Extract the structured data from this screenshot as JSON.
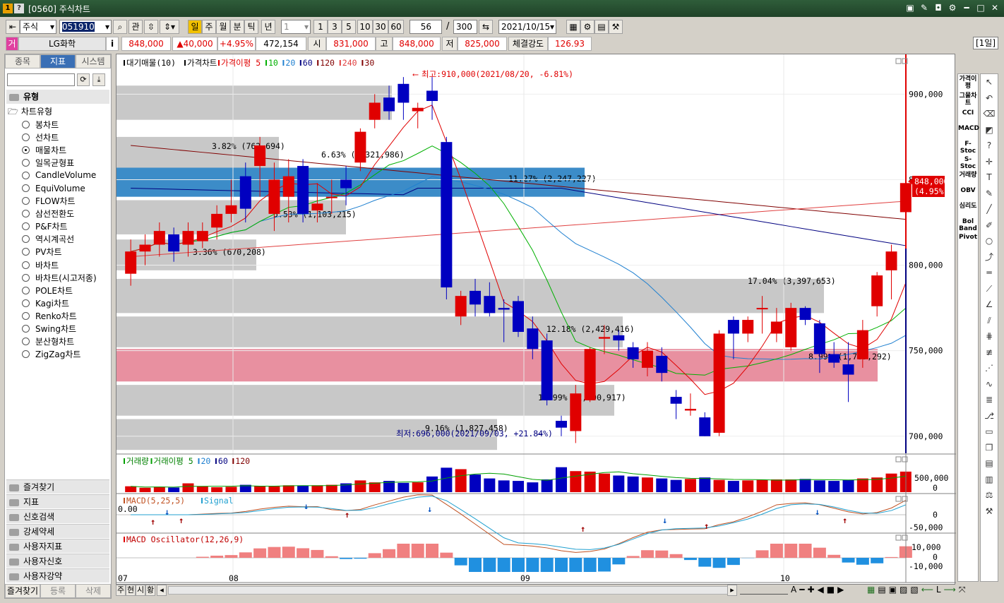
{
  "window": {
    "badge1": "1",
    "badge2": "?",
    "title": "[0560] 주식차트"
  },
  "toolbar": {
    "market": "주식",
    "code": "051910",
    "btn_gwan": "관",
    "units": [
      "일",
      "주",
      "월",
      "분",
      "틱",
      "년"
    ],
    "interval_value": "1",
    "quick_intervals": [
      "1",
      "3",
      "5",
      "10",
      "30",
      "60"
    ],
    "count_value": "56",
    "slash": "/",
    "total_value": "300",
    "date_value": "2021/10/15"
  },
  "quote": {
    "badge": "거",
    "name": "LG화학",
    "info_icon": "i",
    "price": "848,000",
    "change": "▲40,000",
    "change_pct": "+4.95%",
    "volume": "472,154",
    "open_label": "시",
    "open": "831,000",
    "high_label": "고",
    "high": "848,000",
    "low_label": "저",
    "low": "825,000",
    "strength_label": "체결강도",
    "strength": "126.93",
    "period_tag": "[1일]"
  },
  "left_panel": {
    "tabs": [
      "종목",
      "지표",
      "시스템"
    ],
    "active_tab": 1,
    "section": "유형",
    "tree_root": "차트유형",
    "chart_types": [
      "봉차트",
      "선차트",
      "매물차트",
      "일목균형표",
      "CandleVolume",
      "EquiVolume",
      "FLOW차트",
      "삼선전환도",
      "P&F차트",
      "역시계곡선",
      "PV차트",
      "바차트",
      "바차트(시고저종)",
      "POLE차트",
      "Kagi차트",
      "Renko차트",
      "Swing차트",
      "분산형차트",
      "ZigZag차트"
    ],
    "selected_type": 2,
    "bottom_folders": [
      "즐겨찾기",
      "지표",
      "신호검색",
      "강세약세",
      "사용자지표",
      "사용자신호",
      "사용자강약"
    ],
    "footer": [
      "즐겨찾기",
      "등록",
      "삭제"
    ]
  },
  "legend_main": [
    {
      "text": "대기매물(10)",
      "color": "#000000"
    },
    {
      "text": "가격차트",
      "color": "#000000"
    },
    {
      "text": "가격이평 5",
      "color": "#e00000"
    },
    {
      "text": "10",
      "color": "#00b000"
    },
    {
      "text": "20",
      "color": "#2080d0"
    },
    {
      "text": "60",
      "color": "#000080"
    },
    {
      "text": "120",
      "color": "#800000"
    },
    {
      "text": "240",
      "color": "#e04040"
    },
    {
      "text": "30",
      "color": "#800000"
    }
  ],
  "annotations": {
    "high": "최고:910,000(2021/08/20, -6.81%)",
    "low": "최저:696,000(2021/09/03, +21.84%)",
    "current_price": "848,000",
    "current_pct": "(4.95%)"
  },
  "volume_profile": [
    {
      "label": "6.63% (1,321,986)",
      "color": "gray"
    },
    {
      "label": "3.82% (762,694)",
      "color": "gray"
    },
    {
      "label": "11.27% (2,247,227)",
      "color": "blue"
    },
    {
      "label": "5.53% (1,103,215)",
      "color": "gray"
    },
    {
      "label": "3.36% (670,208)",
      "color": "gray"
    },
    {
      "label": "17.04% (3,397,653)",
      "color": "gray"
    },
    {
      "label": "12.18% (2,429,416)",
      "color": "gray"
    },
    {
      "label": "8.99% (1,789,292)",
      "color": "pink"
    },
    {
      "label": "11.99% (2,390,917)",
      "color": "gray"
    },
    {
      "label": "9.16% (1,827,458)",
      "color": "gray"
    }
  ],
  "price_axis": [
    "900,000",
    "850,000",
    "800,000",
    "750,000",
    "700,000"
  ],
  "volume_panel": {
    "legend": [
      "거래량",
      "거래이평 5",
      "20",
      "60",
      "120"
    ],
    "axis": [
      "500,000",
      "0"
    ]
  },
  "macd_panel": {
    "legend": [
      "MACD(5,25,5)",
      "Signal"
    ],
    "value": "0.00",
    "axis": [
      "0",
      "-50,000"
    ]
  },
  "osc_panel": {
    "legend": "MACD Oscillator(12,26,9)",
    "axis": [
      "10,000",
      "0",
      "-10,000"
    ]
  },
  "x_axis": [
    "07",
    "08",
    "09",
    "10"
  ],
  "right_indicators": [
    "가격이평",
    "그물차트",
    "CCI",
    "MACD",
    "F-Stoc",
    "S-Stoc",
    "거래량",
    "OBV",
    "심리도",
    "Bol Band",
    "Pivot"
  ],
  "bottom_bar": {
    "buttons": [
      "주",
      "현",
      "시",
      "황"
    ]
  },
  "colors": {
    "up": "#e00000",
    "down": "#0000c0",
    "band_gray": "#c8c8c8",
    "band_blue": "#3c8cc8",
    "band_pink": "#e890a0"
  },
  "chart_data": {
    "type": "candlestick",
    "x_axis_labels": [
      "07",
      "08",
      "09",
      "10"
    ],
    "y_range": [
      690000,
      915000
    ],
    "candles": [
      {
        "o": 795000,
        "h": 815000,
        "l": 788000,
        "c": 808000
      },
      {
        "o": 808000,
        "h": 818000,
        "l": 800000,
        "c": 812000
      },
      {
        "o": 812000,
        "h": 825000,
        "l": 805000,
        "c": 820000
      },
      {
        "o": 818000,
        "h": 822000,
        "l": 802000,
        "c": 808000
      },
      {
        "o": 812000,
        "h": 825000,
        "l": 805000,
        "c": 820000
      },
      {
        "o": 814000,
        "h": 825000,
        "l": 810000,
        "c": 820000
      },
      {
        "o": 822000,
        "h": 835000,
        "l": 815000,
        "c": 830000
      },
      {
        "o": 830000,
        "h": 850000,
        "l": 825000,
        "c": 835000
      },
      {
        "o": 852000,
        "h": 860000,
        "l": 825000,
        "c": 833000
      },
      {
        "o": 858000,
        "h": 875000,
        "l": 840000,
        "c": 870000
      },
      {
        "o": 830000,
        "h": 860000,
        "l": 820000,
        "c": 850000
      },
      {
        "o": 840000,
        "h": 862000,
        "l": 825000,
        "c": 852000
      },
      {
        "o": 858000,
        "h": 862000,
        "l": 825000,
        "c": 830000
      },
      {
        "o": 832000,
        "h": 848000,
        "l": 825000,
        "c": 836000
      },
      {
        "o": 840000,
        "h": 850000,
        "l": 830000,
        "c": 840000
      },
      {
        "o": 850000,
        "h": 858000,
        "l": 835000,
        "c": 845000
      },
      {
        "o": 860000,
        "h": 880000,
        "l": 855000,
        "c": 878000
      },
      {
        "o": 885000,
        "h": 900000,
        "l": 880000,
        "c": 895000
      },
      {
        "o": 898000,
        "h": 905000,
        "l": 885000,
        "c": 890000
      },
      {
        "o": 906000,
        "h": 910000,
        "l": 885000,
        "c": 895000
      },
      {
        "o": 890000,
        "h": 895000,
        "l": 880000,
        "c": 892000
      },
      {
        "o": 902000,
        "h": 910000,
        "l": 885000,
        "c": 896000
      },
      {
        "o": 872000,
        "h": 875000,
        "l": 780000,
        "c": 787000
      },
      {
        "o": 770000,
        "h": 785000,
        "l": 765000,
        "c": 782000
      },
      {
        "o": 785000,
        "h": 792000,
        "l": 770000,
        "c": 777000
      },
      {
        "o": 782000,
        "h": 790000,
        "l": 770000,
        "c": 772000
      },
      {
        "o": 775000,
        "h": 780000,
        "l": 755000,
        "c": 774000
      },
      {
        "o": 779000,
        "h": 782000,
        "l": 758000,
        "c": 761000
      },
      {
        "o": 763000,
        "h": 770000,
        "l": 745000,
        "c": 751000
      },
      {
        "o": 756000,
        "h": 760000,
        "l": 718000,
        "c": 721000
      },
      {
        "o": 709000,
        "h": 712000,
        "l": 700000,
        "c": 705000
      },
      {
        "o": 703000,
        "h": 730000,
        "l": 696000,
        "c": 725000
      },
      {
        "o": 721000,
        "h": 752000,
        "l": 720000,
        "c": 751000
      },
      {
        "o": 757000,
        "h": 765000,
        "l": 748000,
        "c": 758000
      },
      {
        "o": 759000,
        "h": 762000,
        "l": 750000,
        "c": 756000
      },
      {
        "o": 752000,
        "h": 755000,
        "l": 740000,
        "c": 745000
      },
      {
        "o": 740000,
        "h": 755000,
        "l": 735000,
        "c": 750000
      },
      {
        "o": 747000,
        "h": 752000,
        "l": 732000,
        "c": 737000
      },
      {
        "o": 723000,
        "h": 727000,
        "l": 710000,
        "c": 719000
      },
      {
        "o": 715000,
        "h": 725000,
        "l": 712000,
        "c": 716000
      },
      {
        "o": 711000,
        "h": 714000,
        "l": 700000,
        "c": 700000
      },
      {
        "o": 702000,
        "h": 762000,
        "l": 700000,
        "c": 760000
      },
      {
        "o": 768000,
        "h": 770000,
        "l": 745000,
        "c": 760000
      },
      {
        "o": 760000,
        "h": 770000,
        "l": 755000,
        "c": 768000
      },
      {
        "o": 775000,
        "h": 782000,
        "l": 760000,
        "c": 775000
      },
      {
        "o": 760000,
        "h": 775000,
        "l": 755000,
        "c": 767000
      },
      {
        "o": 752000,
        "h": 778000,
        "l": 750000,
        "c": 775000
      },
      {
        "o": 775000,
        "h": 776000,
        "l": 765000,
        "c": 768000
      },
      {
        "o": 766000,
        "h": 768000,
        "l": 737000,
        "c": 748000
      },
      {
        "o": 748000,
        "h": 755000,
        "l": 740000,
        "c": 743000
      },
      {
        "o": 742000,
        "h": 755000,
        "l": 720000,
        "c": 736000
      },
      {
        "o": 745000,
        "h": 768000,
        "l": 740000,
        "c": 762000
      },
      {
        "o": 776000,
        "h": 796000,
        "l": 770000,
        "c": 794000
      },
      {
        "o": 797000,
        "h": 812000,
        "l": 780000,
        "c": 808000
      },
      {
        "o": 831000,
        "h": 848000,
        "l": 825000,
        "c": 848000
      }
    ],
    "volume": [
      120,
      90,
      110,
      95,
      180,
      120,
      100,
      110,
      150,
      130,
      120,
      140,
      130,
      140,
      150,
      180,
      240,
      200,
      230,
      190,
      200,
      320,
      500,
      470,
      360,
      280,
      240,
      230,
      200,
      260,
      510,
      430,
      420,
      380,
      340,
      320,
      300,
      280,
      250,
      270,
      300,
      250,
      230,
      240,
      250,
      260,
      260,
      270,
      240,
      230,
      250,
      280,
      300,
      380,
      420
    ]
  }
}
